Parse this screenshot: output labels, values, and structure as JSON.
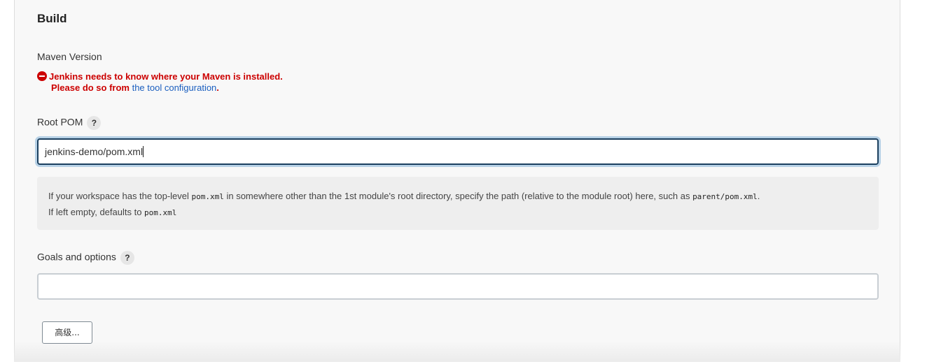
{
  "section": {
    "title": "Build"
  },
  "maven_version": {
    "label": "Maven Version",
    "error_line1": "Jenkins needs to know where your Maven is installed.",
    "error_line2_prefix": "Please do so from ",
    "error_link": "the tool configuration",
    "error_line2_suffix": "."
  },
  "root_pom": {
    "label": "Root POM",
    "help_label": "?",
    "value": "jenkins-demo/pom.xml",
    "help": {
      "line1_a": "If your workspace has the top-level ",
      "line1_code1": "pom.xml",
      "line1_b": " in somewhere other than the 1st module's root directory, specify the path (relative to the module root) here, such as ",
      "line1_code2": "parent/pom.xml",
      "line1_c": ".",
      "line2_a": "If left empty, defaults to ",
      "line2_code": "pom.xml"
    }
  },
  "goals": {
    "label": "Goals and options",
    "help_label": "?",
    "value": ""
  },
  "advanced": {
    "label": "高级..."
  },
  "colors": {
    "error": "#cc0000",
    "link": "#1b5fbf",
    "focus_border": "#1b3f5e"
  }
}
